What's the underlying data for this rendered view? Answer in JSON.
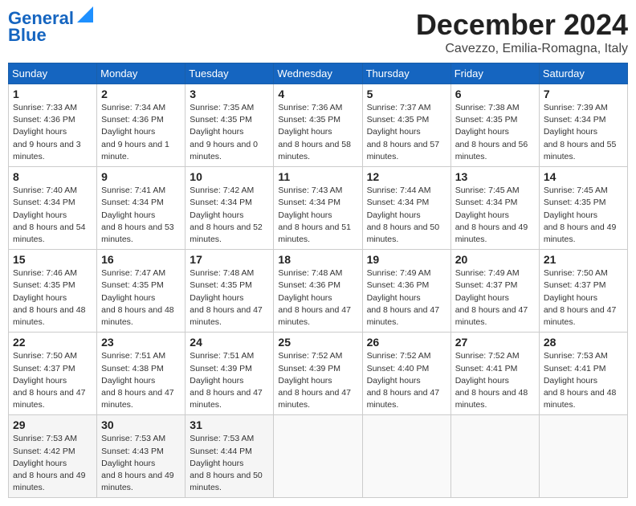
{
  "header": {
    "logo_line1": "General",
    "logo_line2": "Blue",
    "month": "December 2024",
    "location": "Cavezzo, Emilia-Romagna, Italy"
  },
  "days_of_week": [
    "Sunday",
    "Monday",
    "Tuesday",
    "Wednesday",
    "Thursday",
    "Friday",
    "Saturday"
  ],
  "weeks": [
    [
      {
        "day": "1",
        "sunrise": "7:33 AM",
        "sunset": "4:36 PM",
        "daylight": "9 hours and 3 minutes."
      },
      {
        "day": "2",
        "sunrise": "7:34 AM",
        "sunset": "4:36 PM",
        "daylight": "9 hours and 1 minute."
      },
      {
        "day": "3",
        "sunrise": "7:35 AM",
        "sunset": "4:35 PM",
        "daylight": "9 hours and 0 minutes."
      },
      {
        "day": "4",
        "sunrise": "7:36 AM",
        "sunset": "4:35 PM",
        "daylight": "8 hours and 58 minutes."
      },
      {
        "day": "5",
        "sunrise": "7:37 AM",
        "sunset": "4:35 PM",
        "daylight": "8 hours and 57 minutes."
      },
      {
        "day": "6",
        "sunrise": "7:38 AM",
        "sunset": "4:35 PM",
        "daylight": "8 hours and 56 minutes."
      },
      {
        "day": "7",
        "sunrise": "7:39 AM",
        "sunset": "4:34 PM",
        "daylight": "8 hours and 55 minutes."
      }
    ],
    [
      {
        "day": "8",
        "sunrise": "7:40 AM",
        "sunset": "4:34 PM",
        "daylight": "8 hours and 54 minutes."
      },
      {
        "day": "9",
        "sunrise": "7:41 AM",
        "sunset": "4:34 PM",
        "daylight": "8 hours and 53 minutes."
      },
      {
        "day": "10",
        "sunrise": "7:42 AM",
        "sunset": "4:34 PM",
        "daylight": "8 hours and 52 minutes."
      },
      {
        "day": "11",
        "sunrise": "7:43 AM",
        "sunset": "4:34 PM",
        "daylight": "8 hours and 51 minutes."
      },
      {
        "day": "12",
        "sunrise": "7:44 AM",
        "sunset": "4:34 PM",
        "daylight": "8 hours and 50 minutes."
      },
      {
        "day": "13",
        "sunrise": "7:45 AM",
        "sunset": "4:34 PM",
        "daylight": "8 hours and 49 minutes."
      },
      {
        "day": "14",
        "sunrise": "7:45 AM",
        "sunset": "4:35 PM",
        "daylight": "8 hours and 49 minutes."
      }
    ],
    [
      {
        "day": "15",
        "sunrise": "7:46 AM",
        "sunset": "4:35 PM",
        "daylight": "8 hours and 48 minutes."
      },
      {
        "day": "16",
        "sunrise": "7:47 AM",
        "sunset": "4:35 PM",
        "daylight": "8 hours and 48 minutes."
      },
      {
        "day": "17",
        "sunrise": "7:48 AM",
        "sunset": "4:35 PM",
        "daylight": "8 hours and 47 minutes."
      },
      {
        "day": "18",
        "sunrise": "7:48 AM",
        "sunset": "4:36 PM",
        "daylight": "8 hours and 47 minutes."
      },
      {
        "day": "19",
        "sunrise": "7:49 AM",
        "sunset": "4:36 PM",
        "daylight": "8 hours and 47 minutes."
      },
      {
        "day": "20",
        "sunrise": "7:49 AM",
        "sunset": "4:37 PM",
        "daylight": "8 hours and 47 minutes."
      },
      {
        "day": "21",
        "sunrise": "7:50 AM",
        "sunset": "4:37 PM",
        "daylight": "8 hours and 47 minutes."
      }
    ],
    [
      {
        "day": "22",
        "sunrise": "7:50 AM",
        "sunset": "4:37 PM",
        "daylight": "8 hours and 47 minutes."
      },
      {
        "day": "23",
        "sunrise": "7:51 AM",
        "sunset": "4:38 PM",
        "daylight": "8 hours and 47 minutes."
      },
      {
        "day": "24",
        "sunrise": "7:51 AM",
        "sunset": "4:39 PM",
        "daylight": "8 hours and 47 minutes."
      },
      {
        "day": "25",
        "sunrise": "7:52 AM",
        "sunset": "4:39 PM",
        "daylight": "8 hours and 47 minutes."
      },
      {
        "day": "26",
        "sunrise": "7:52 AM",
        "sunset": "4:40 PM",
        "daylight": "8 hours and 47 minutes."
      },
      {
        "day": "27",
        "sunrise": "7:52 AM",
        "sunset": "4:41 PM",
        "daylight": "8 hours and 48 minutes."
      },
      {
        "day": "28",
        "sunrise": "7:53 AM",
        "sunset": "4:41 PM",
        "daylight": "8 hours and 48 minutes."
      }
    ],
    [
      {
        "day": "29",
        "sunrise": "7:53 AM",
        "sunset": "4:42 PM",
        "daylight": "8 hours and 49 minutes."
      },
      {
        "day": "30",
        "sunrise": "7:53 AM",
        "sunset": "4:43 PM",
        "daylight": "8 hours and 49 minutes."
      },
      {
        "day": "31",
        "sunrise": "7:53 AM",
        "sunset": "4:44 PM",
        "daylight": "8 hours and 50 minutes."
      },
      null,
      null,
      null,
      null
    ]
  ]
}
